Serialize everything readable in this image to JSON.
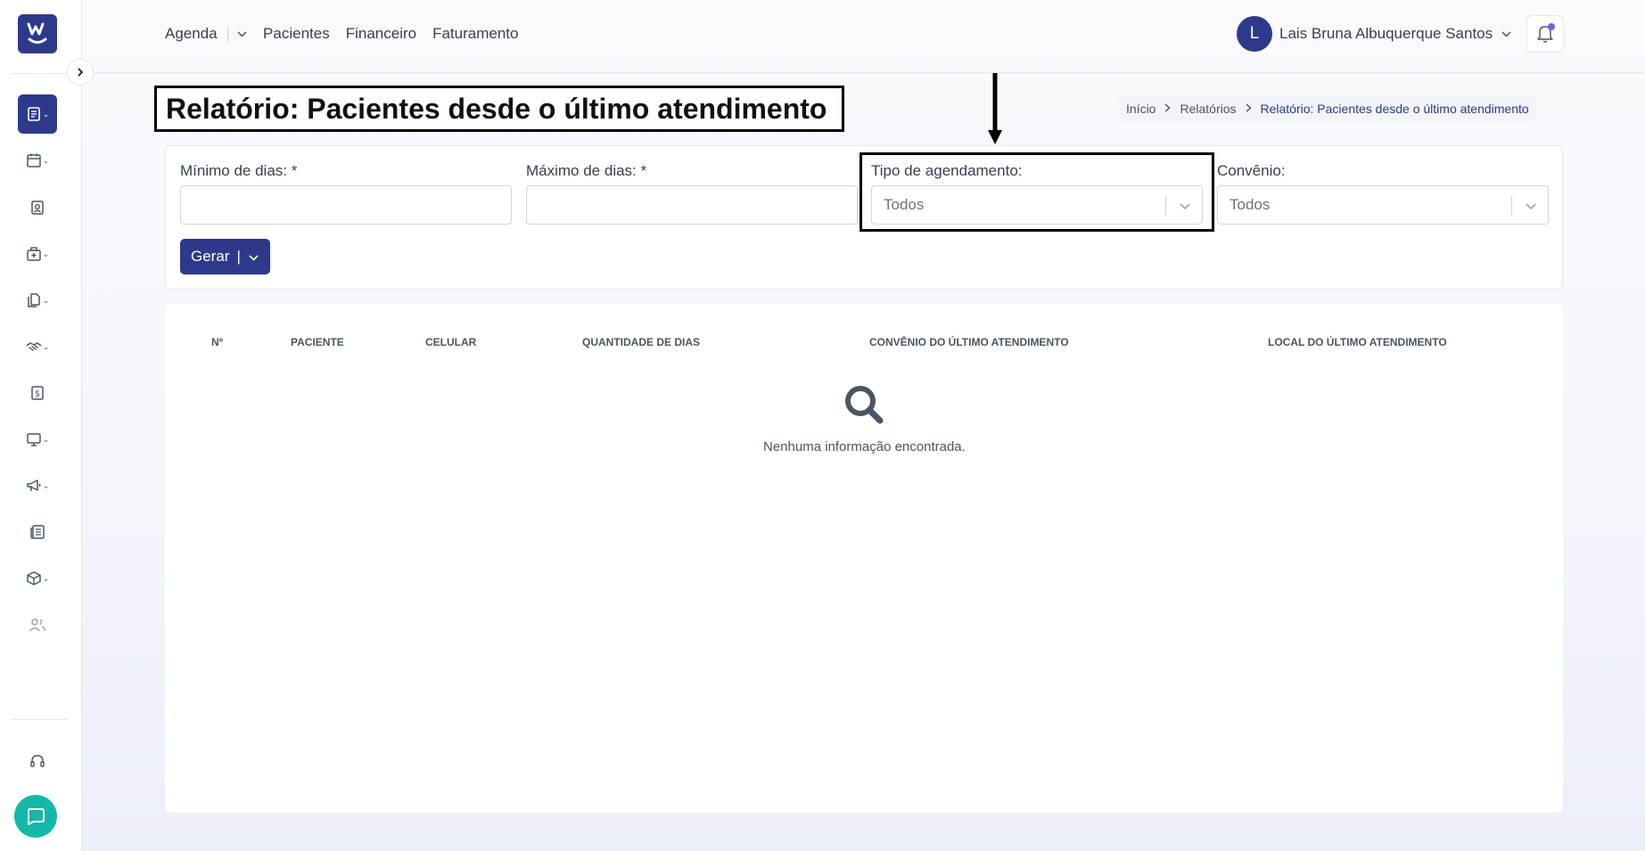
{
  "topnav": {
    "agenda": "Agenda",
    "pacientes": "Pacientes",
    "financeiro": "Financeiro",
    "faturamento": "Faturamento"
  },
  "user": {
    "initial": "L",
    "name": "Lais Bruna Albuquerque Santos"
  },
  "page": {
    "title": "Relatório: Pacientes desde o último atendimento"
  },
  "breadcrumb": {
    "home": "Início",
    "reports": "Relatórios",
    "current": "Relatório: Pacientes desde o último atendimento"
  },
  "filters": {
    "min_days_label": "Mínimo de dias: *",
    "max_days_label": "Máximo de dias: *",
    "scheduling_type_label": "Tipo de agendamento:",
    "scheduling_type_value": "Todos",
    "insurance_label": "Convênio:",
    "insurance_value": "Todos",
    "generate_label": "Gerar"
  },
  "table": {
    "columns": [
      "Nº",
      "PACIENTE",
      "CELULAR",
      "QUANTIDADE DE DIAS",
      "CONVÊNIO DO ÚLTIMO ATENDIMENTO",
      "LOCAL DO ÚLTIMO ATENDIMENTO"
    ],
    "empty_message": "Nenhuma informação encontrada."
  },
  "sidebar": {
    "icons": [
      "reports-icon",
      "calendar-icon",
      "patient-icon",
      "medical-kit-icon",
      "documents-icon",
      "handshake-icon",
      "billing-icon",
      "monitor-icon",
      "megaphone-icon",
      "news-icon",
      "package-icon",
      "users-icon",
      "headset-icon"
    ]
  },
  "colors": {
    "primary": "#2d3a8c",
    "chat": "#14b8a6",
    "notification_dot": "#6366f1"
  }
}
